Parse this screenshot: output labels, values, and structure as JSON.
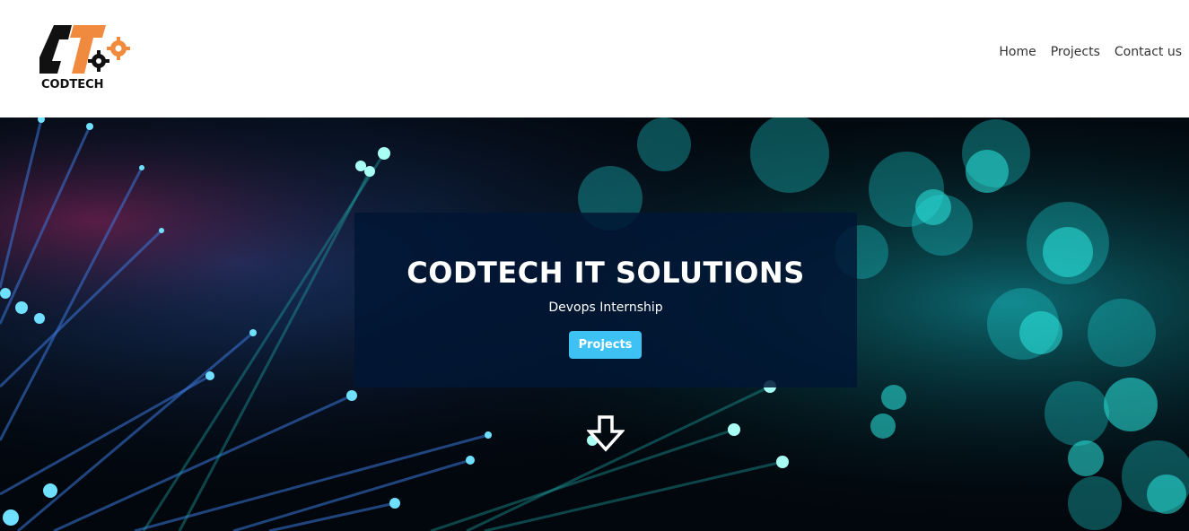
{
  "header": {
    "logo_text": "CODTECH",
    "nav": [
      {
        "label": "Home"
      },
      {
        "label": "Projects"
      },
      {
        "label": "Contact us"
      }
    ]
  },
  "hero": {
    "title": "CODTECH IT SOLUTIONS",
    "subtitle": "Devops Internship",
    "button_label": "Projects",
    "scroll_icon": "arrow-down-icon"
  },
  "colors": {
    "logo_black": "#111111",
    "logo_orange": "#f08a3e",
    "panel_bg": "#011634",
    "button_bg": "#3ec1f3",
    "hero_accent": "#17d6d6"
  }
}
